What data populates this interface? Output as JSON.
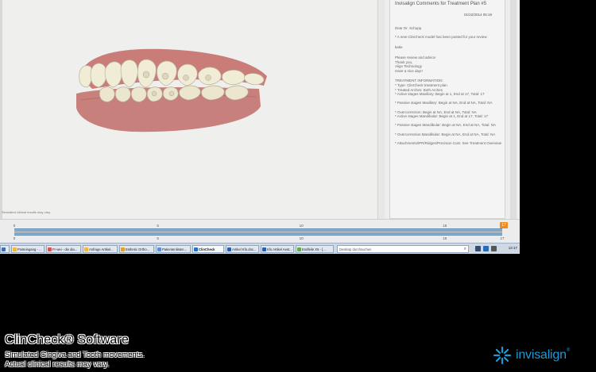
{
  "viewport": {
    "disclaimer": "Simulated clinical results may vary."
  },
  "comments": {
    "title": "Invisalign Comments for Treatment Plan #5",
    "date": "01/22/2014 05:19",
    "greeting": "Dear Dr. Schupp",
    "posted_note": "* A new ClinCheck model  has been posted for your review",
    "signer": "katie",
    "closing_lines": [
      "Please review and advice",
      "Thank you,",
      "Align Technology",
      "Have a nice day!!"
    ],
    "info_heading": "TREATMENT INFORMATION:",
    "info_lines": [
      "* Type: ClinCheck treatment plan",
      "* Treated Arches: Both Arches",
      "* Active stages Maxillary: Begin at 1, End at 17, Total: 17",
      "* Passive stages Maxillary: Begin at NA, End at NA, Total: NA",
      "* Overcorrection: Begin at NA, End at NA, Total: NA",
      "* Active stages Mandibular: Begin at 1, End at 17, Total: 17",
      "* Passive stages Mandibular: Begin at NA, End at NA, Total: NA",
      "* Overcorrection Mandibular: Begin at NA, End at NA, Total: NA",
      "* Attachments/IPR/Ridges/Precision Cuts: See Treatment Overview"
    ]
  },
  "timeline": {
    "ticks_upper": [
      "0",
      "5",
      "10",
      "15"
    ],
    "ticks_lower": [
      "0",
      "5",
      "10",
      "15",
      "17"
    ],
    "current_stage": "17",
    "max_stage": 17
  },
  "taskbar": {
    "buttons": [
      {
        "label": "",
        "color": "#3f6fb0"
      },
      {
        "label": "Posteingang - ...",
        "color": "#f0b640"
      },
      {
        "label": "Fr-wei - die dia...",
        "color": "#d9534f"
      },
      {
        "label": "Anfrage Artikel...",
        "color": "#f0b640"
      },
      {
        "label": "Esthetic Ortho...",
        "color": "#e0a030"
      },
      {
        "label": "Patientenlisten...",
        "color": "#5a8fd0"
      },
      {
        "label": "ClinCheck",
        "color": "#2a6fbf",
        "active": true
      },
      {
        "label": "Artikel Kfo.doc...",
        "color": "#2b5fad"
      },
      {
        "label": "Kfo Artikel Aest...",
        "color": "#2b5fad"
      },
      {
        "label": "Endfeile X5 - [...",
        "color": "#6aa84f"
      }
    ],
    "search_placeholder": "Desktop durchsuchen",
    "clock": "12:17"
  },
  "branding": {
    "software": "ClinCheck® Software",
    "sub1": "Simulated Gingiva and Tooth movements.",
    "sub2": "Actual clinical results may vary.",
    "logo_word": "invisalign",
    "logo_mark": "®",
    "logo_color": "#1a9bd7"
  }
}
